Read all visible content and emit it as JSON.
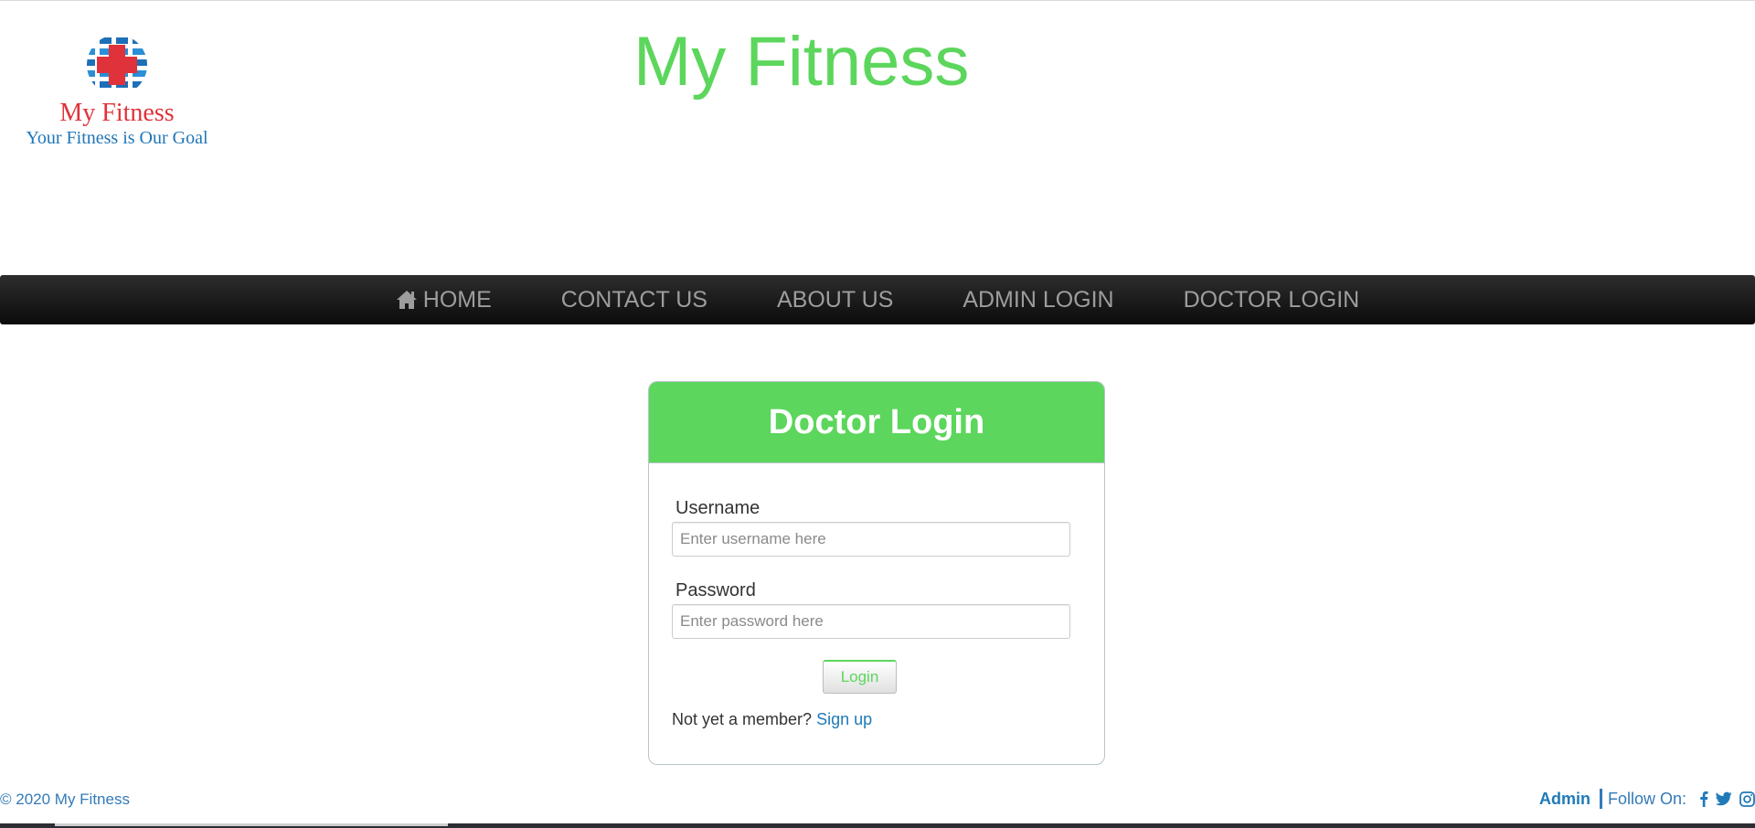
{
  "header": {
    "logo": {
      "name": "My Fitness",
      "tagline": "Your Fitness is Our Goal"
    },
    "title": "My Fitness"
  },
  "nav": {
    "items": [
      {
        "label": "HOME",
        "icon": "home-icon"
      },
      {
        "label": "CONTACT US"
      },
      {
        "label": "ABOUT US"
      },
      {
        "label": "ADMIN LOGIN"
      },
      {
        "label": "DOCTOR LOGIN"
      }
    ]
  },
  "login": {
    "title": "Doctor Login",
    "username_label": "Username",
    "username_placeholder": "Enter username here",
    "password_label": "Password",
    "password_placeholder": "Enter password here",
    "button_label": "Login",
    "member_prompt": "Not yet a member?",
    "signup_label": "Sign up"
  },
  "footer": {
    "copyright": "© 2020 My Fitness",
    "admin_label": "Admin",
    "follow_label": "Follow On:",
    "social_icons": [
      "facebook-icon",
      "twitter-icon",
      "instagram-icon"
    ]
  },
  "colors": {
    "brand_green": "#5cd65c",
    "link_blue": "#1f7ab8",
    "navbar_dark": "#1b1b1b",
    "logo_red": "#e0323a"
  }
}
